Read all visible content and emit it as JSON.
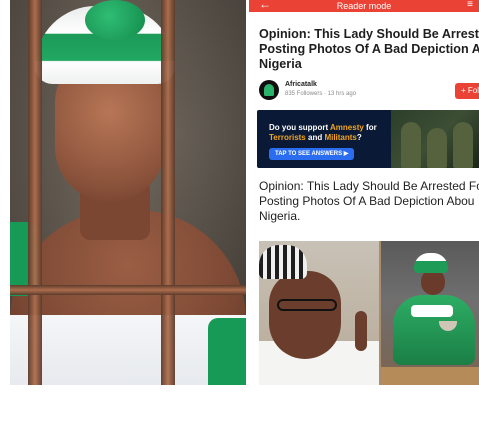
{
  "reader": {
    "back_glyph": "←",
    "title": "Reader mode",
    "menu_glyph": "≡"
  },
  "article": {
    "headline_lines": [
      "Opinion: This Lady Should Be Arrested F",
      "Posting Photos Of A Bad Depiction Ab",
      "Nigeria"
    ],
    "publisher": {
      "name": "Africatalk",
      "meta": "835 Followers · 13 hrs ago",
      "follow_label": "+ Follo"
    },
    "ad": {
      "line1_prefix": "Do you support ",
      "line1_highlight": "Amnesty",
      "line1_suffix": " for",
      "line2_highlight": "Terrorists",
      "line2_mid": " and ",
      "line2_highlight2": "Militants",
      "line2_suffix": "?",
      "cta": "TAP TO SEE ANSWERS ▶"
    },
    "body_lines": [
      "Opinion: This Lady Should Be Arrested Fo",
      "Posting Photos Of A Bad Depiction Abou",
      "Nigeria."
    ]
  },
  "colors": {
    "accent_red": "#ea4335",
    "nigeria_green": "#179a55",
    "ad_bg": "#0a1a36",
    "ad_highlight": "#f2a51a",
    "ad_button": "#2b6df1"
  },
  "icons": [
    "back-arrow-icon",
    "menu-icon",
    "publisher-logo-icon"
  ]
}
